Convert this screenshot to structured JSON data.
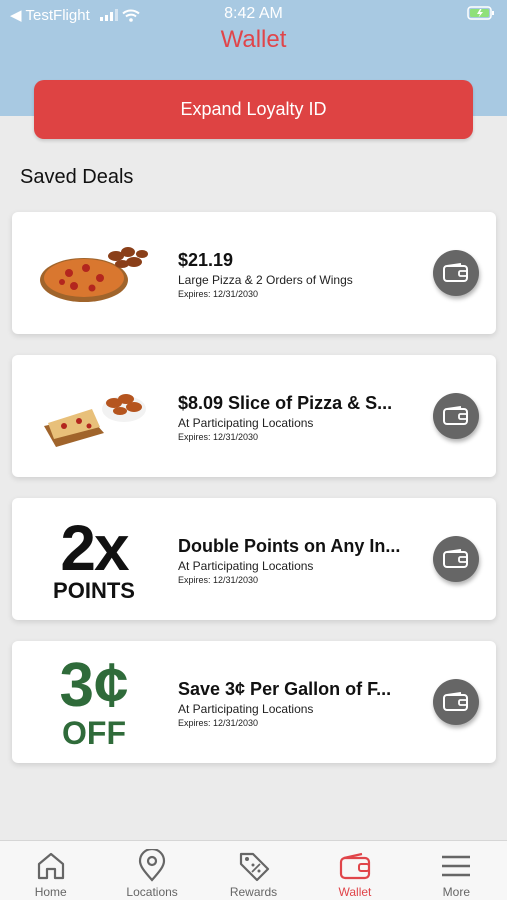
{
  "status": {
    "carrier": "TestFlight",
    "time": "8:42 AM"
  },
  "header": {
    "title": "Wallet"
  },
  "loyalty_button": "Expand Loyalty ID",
  "section_title": "Saved Deals",
  "deals": [
    {
      "title": "$21.19",
      "subtitle": "Large Pizza & 2 Orders of Wings",
      "expires": "Expires: 12/31/2030",
      "image": "pizza-and-wings"
    },
    {
      "title": "$8.09 Slice of Pizza & S...",
      "subtitle": "At Participating Locations",
      "expires": "Expires: 12/31/2030",
      "image": "slice-and-wings"
    },
    {
      "title": "Double Points on Any In...",
      "subtitle": "At Participating Locations",
      "expires": "Expires: 12/31/2030",
      "image": "2x-points",
      "graphic_line1": "2x",
      "graphic_line2": "POINTS"
    },
    {
      "title": "Save 3¢ Per Gallon of F...",
      "subtitle": "At Participating Locations",
      "expires": "Expires: 12/31/2030",
      "image": "3c-off",
      "graphic_line1": "3¢",
      "graphic_line2": "OFF",
      "graphic_color": "#2f6b3a"
    }
  ],
  "tabs": [
    {
      "label": "Home",
      "icon": "home-icon"
    },
    {
      "label": "Locations",
      "icon": "location-pin-icon"
    },
    {
      "label": "Rewards",
      "icon": "tag-percent-icon"
    },
    {
      "label": "Wallet",
      "icon": "wallet-icon",
      "active": true
    },
    {
      "label": "More",
      "icon": "menu-icon"
    }
  ],
  "colors": {
    "accent": "#e0454a",
    "header_bg": "#a8c9e2",
    "button": "#de4343"
  }
}
